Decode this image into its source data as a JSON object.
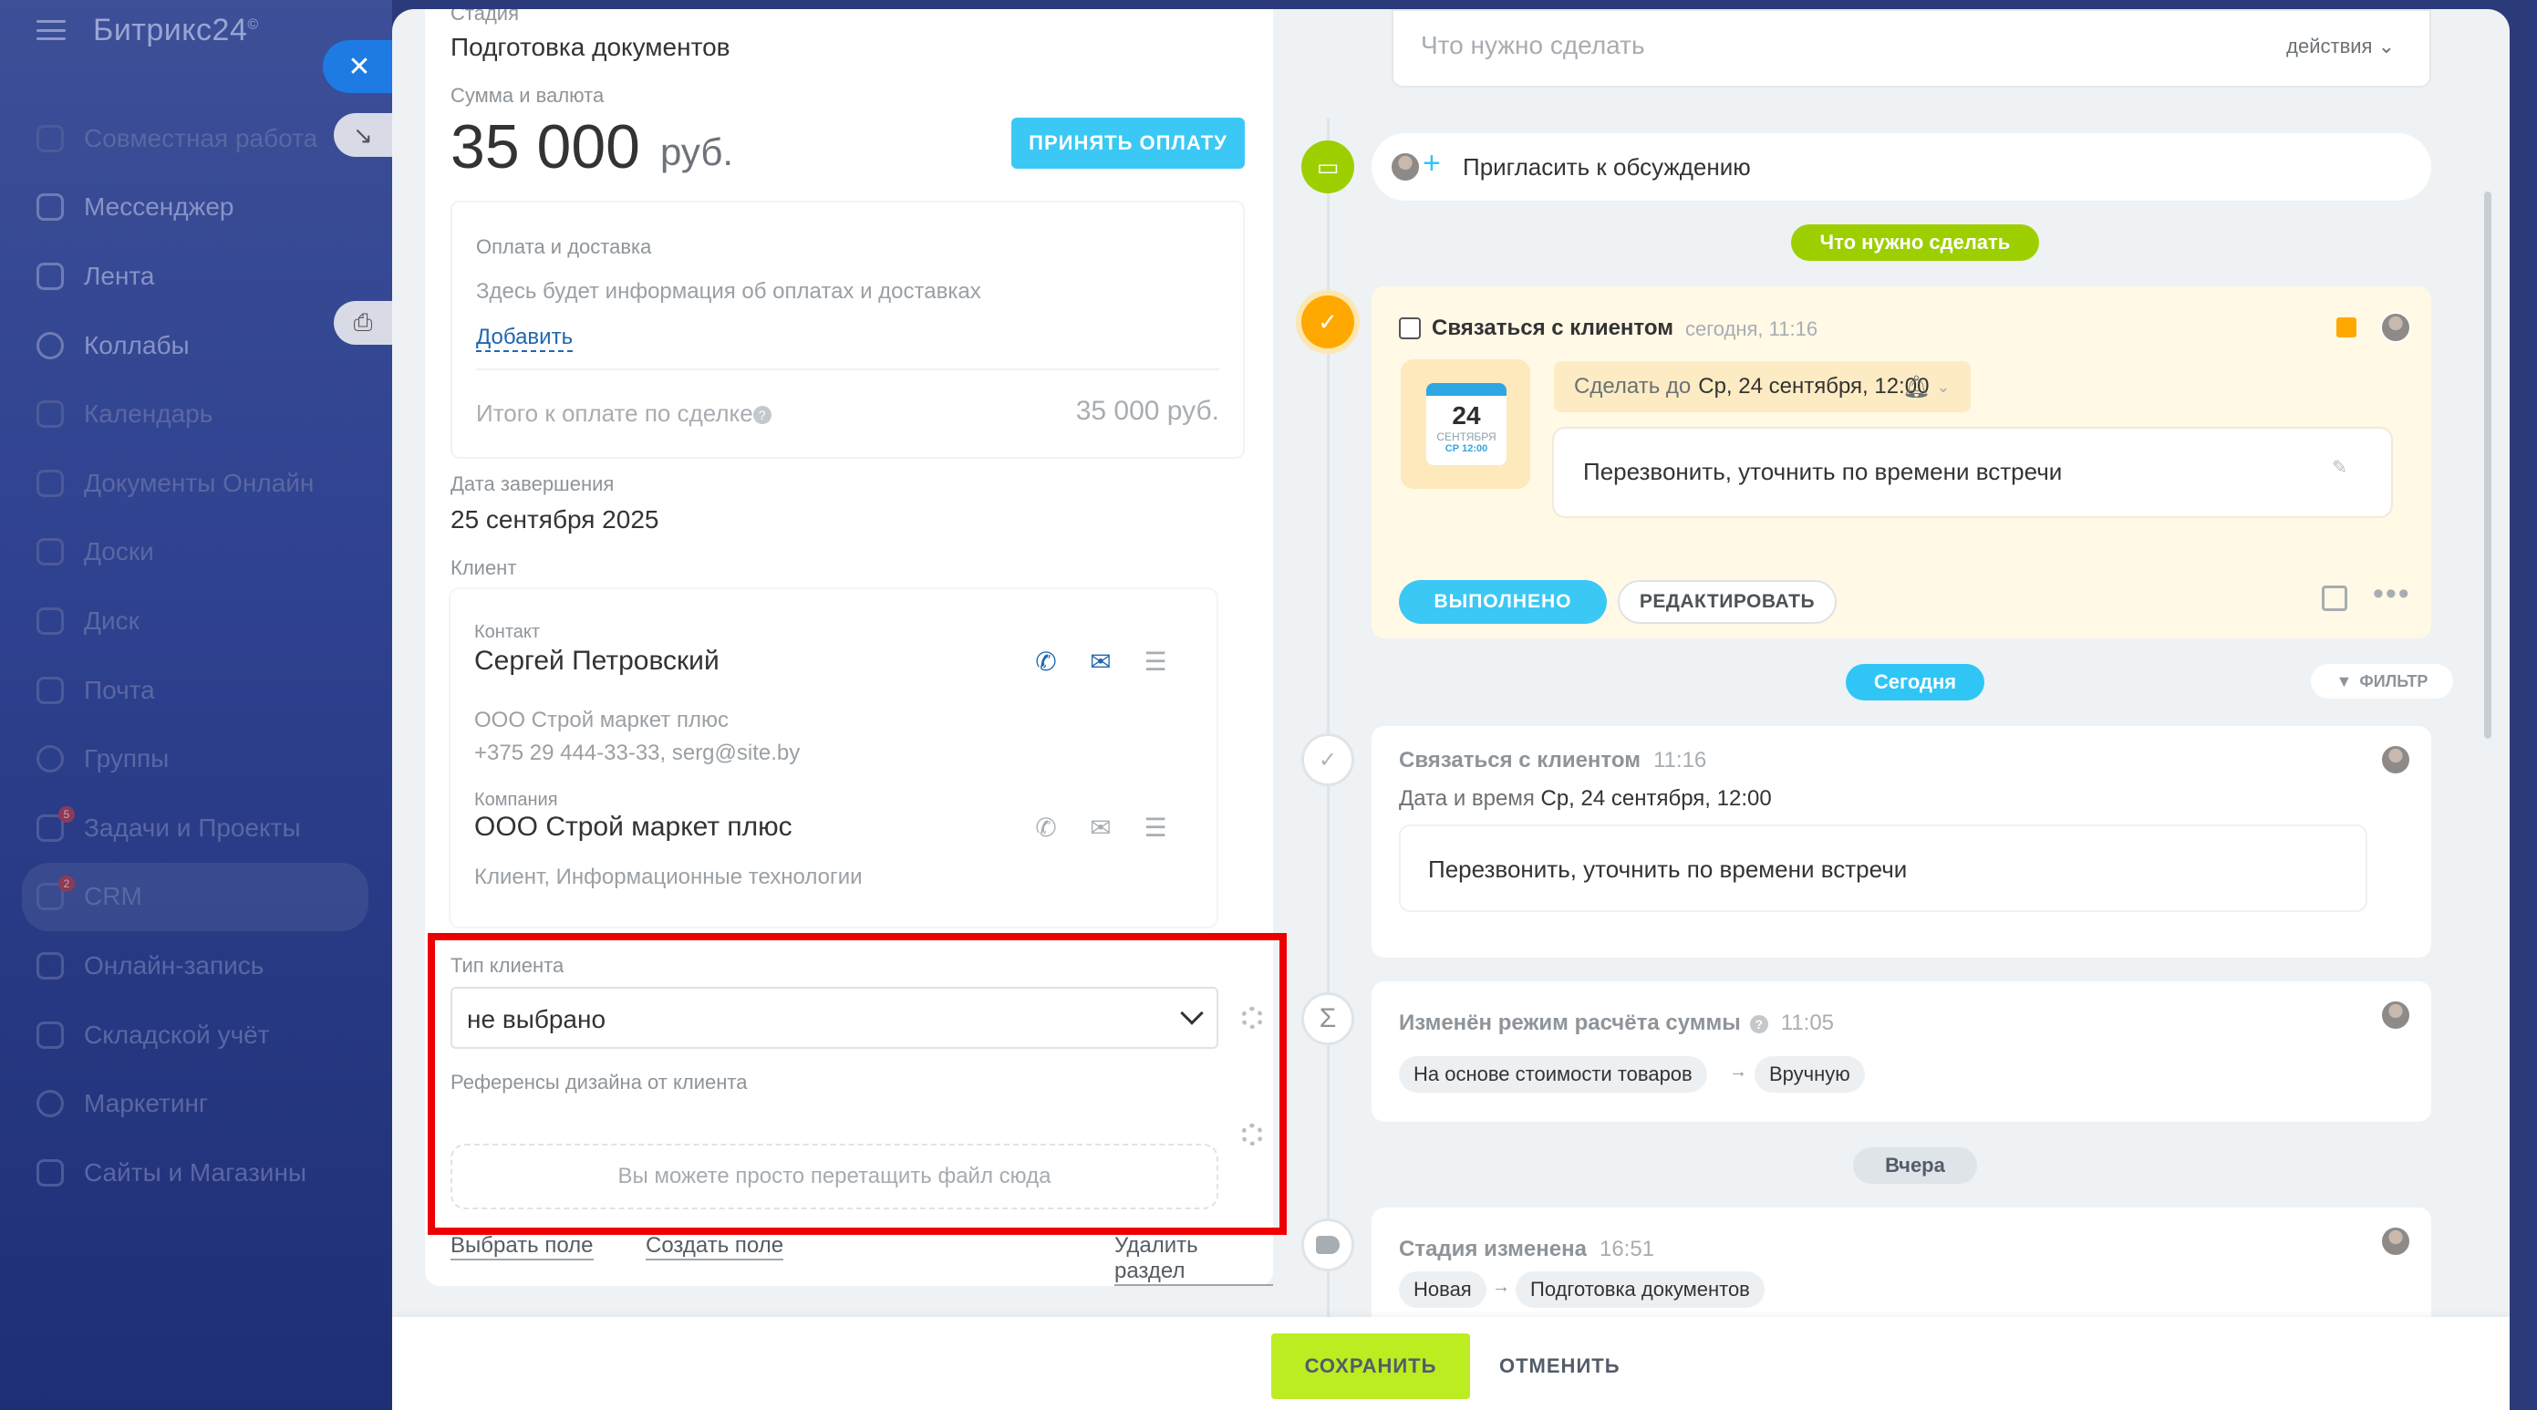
{
  "sidebar": {
    "brand": "Битрикс24",
    "brand_mark": "©",
    "items": [
      {
        "label": "Совместная работа",
        "icon": "collab-icon"
      },
      {
        "label": "Мессенджер",
        "icon": "chat-icon"
      },
      {
        "label": "Лента",
        "icon": "feed-icon"
      },
      {
        "label": "Коллабы",
        "icon": "collab-circle-icon"
      },
      {
        "label": "Календарь",
        "icon": "calendar-icon"
      },
      {
        "label": "Документы Онлайн",
        "icon": "documents-icon"
      },
      {
        "label": "Доски",
        "icon": "boards-icon"
      },
      {
        "label": "Диск",
        "icon": "disk-icon"
      },
      {
        "label": "Почта",
        "icon": "mail-icon"
      },
      {
        "label": "Группы",
        "icon": "groups-icon"
      },
      {
        "label": "Задачи и Проекты",
        "icon": "tasks-icon",
        "badge": "5"
      },
      {
        "label": "CRM",
        "icon": "crm-icon",
        "badge": "2",
        "active": true
      },
      {
        "label": "Онлайн-запись",
        "icon": "booking-icon"
      },
      {
        "label": "Складской учёт",
        "icon": "warehouse-icon"
      },
      {
        "label": "Маркетинг",
        "icon": "marketing-icon"
      },
      {
        "label": "Сайты и Магазины",
        "icon": "sites-icon"
      }
    ]
  },
  "deal": {
    "stage_label": "Стадия",
    "stage_value": "Подготовка документов",
    "sum_label": "Сумма и валюта",
    "sum_value": "35 000",
    "sum_currency": "руб.",
    "accept_payment": "ПРИНЯТЬ ОПЛАТУ",
    "payment": {
      "title": "Оплата и доставка",
      "info": "Здесь будет информация об оплатах и доставках",
      "add": "Добавить",
      "total_label": "Итого к оплате по сделке",
      "total_value": "35 000 руб."
    },
    "close_date_label": "Дата завершения",
    "close_date": "25 сентября 2025",
    "client_label": "Клиент",
    "contact": {
      "small": "Контакт",
      "name": "Сергей Петровский",
      "company": "ООО Строй маркет плюс",
      "details": "+375 29 444-33-33, serg@site.by"
    },
    "company": {
      "small": "Компания",
      "name": "ООО Строй маркет плюс",
      "details": "Клиент, Информационные технологии"
    },
    "client_type_label": "Тип клиента",
    "client_type_value": "не выбрано",
    "refs_label": "Референсы дизайна от клиента",
    "dropzone": "Вы можете просто перетащить файл сюда",
    "choose_field": "Выбрать поле",
    "create_field": "Создать поле",
    "delete_section": "Удалить раздел"
  },
  "timeline": {
    "todo_placeholder": "Что нужно сделать",
    "actions": "действия",
    "invite": "Пригласить к обсуждению",
    "todo_pill": "Что нужно сделать",
    "task": {
      "title": "Связаться с клиентом",
      "time": "сегодня, 11:16",
      "cal_day": "24",
      "cal_month": "СЕНТЯБРЯ",
      "cal_week": "СР 12:00",
      "deadline_prefix": "Сделать до",
      "deadline_value": "Ср, 24 сентября, 12:00",
      "description": "Перезвонить, уточнить по времени встречи",
      "done": "ВЫПОЛНЕНО",
      "edit": "РЕДАКТИРОВАТЬ"
    },
    "today_pill": "Сегодня",
    "filter": "ФИЛЬТР",
    "history1": {
      "title": "Связаться с клиентом",
      "time": "11:16",
      "date_label": "Дата и время",
      "date_value": "Ср, 24 сентября, 12:00",
      "text": "Перезвонить, уточнить по времени встречи"
    },
    "history2": {
      "title": "Изменён режим расчёта суммы",
      "time": "11:05",
      "from": "На основе стоимости товаров",
      "to": "Вручную"
    },
    "yesterday_pill": "Вчера",
    "history3": {
      "title": "Стадия изменена",
      "time": "16:51",
      "from": "Новая",
      "to": "Подготовка документов"
    }
  },
  "footer": {
    "save": "СОХРАНИТЬ",
    "cancel": "ОТМЕНИТЬ"
  },
  "colors": {
    "accent_blue": "#3bc8f5",
    "save_green": "#bbed21",
    "timeline_green": "#9dcf00",
    "highlight_red": "#ef0000",
    "task_orange": "#ffa900"
  }
}
